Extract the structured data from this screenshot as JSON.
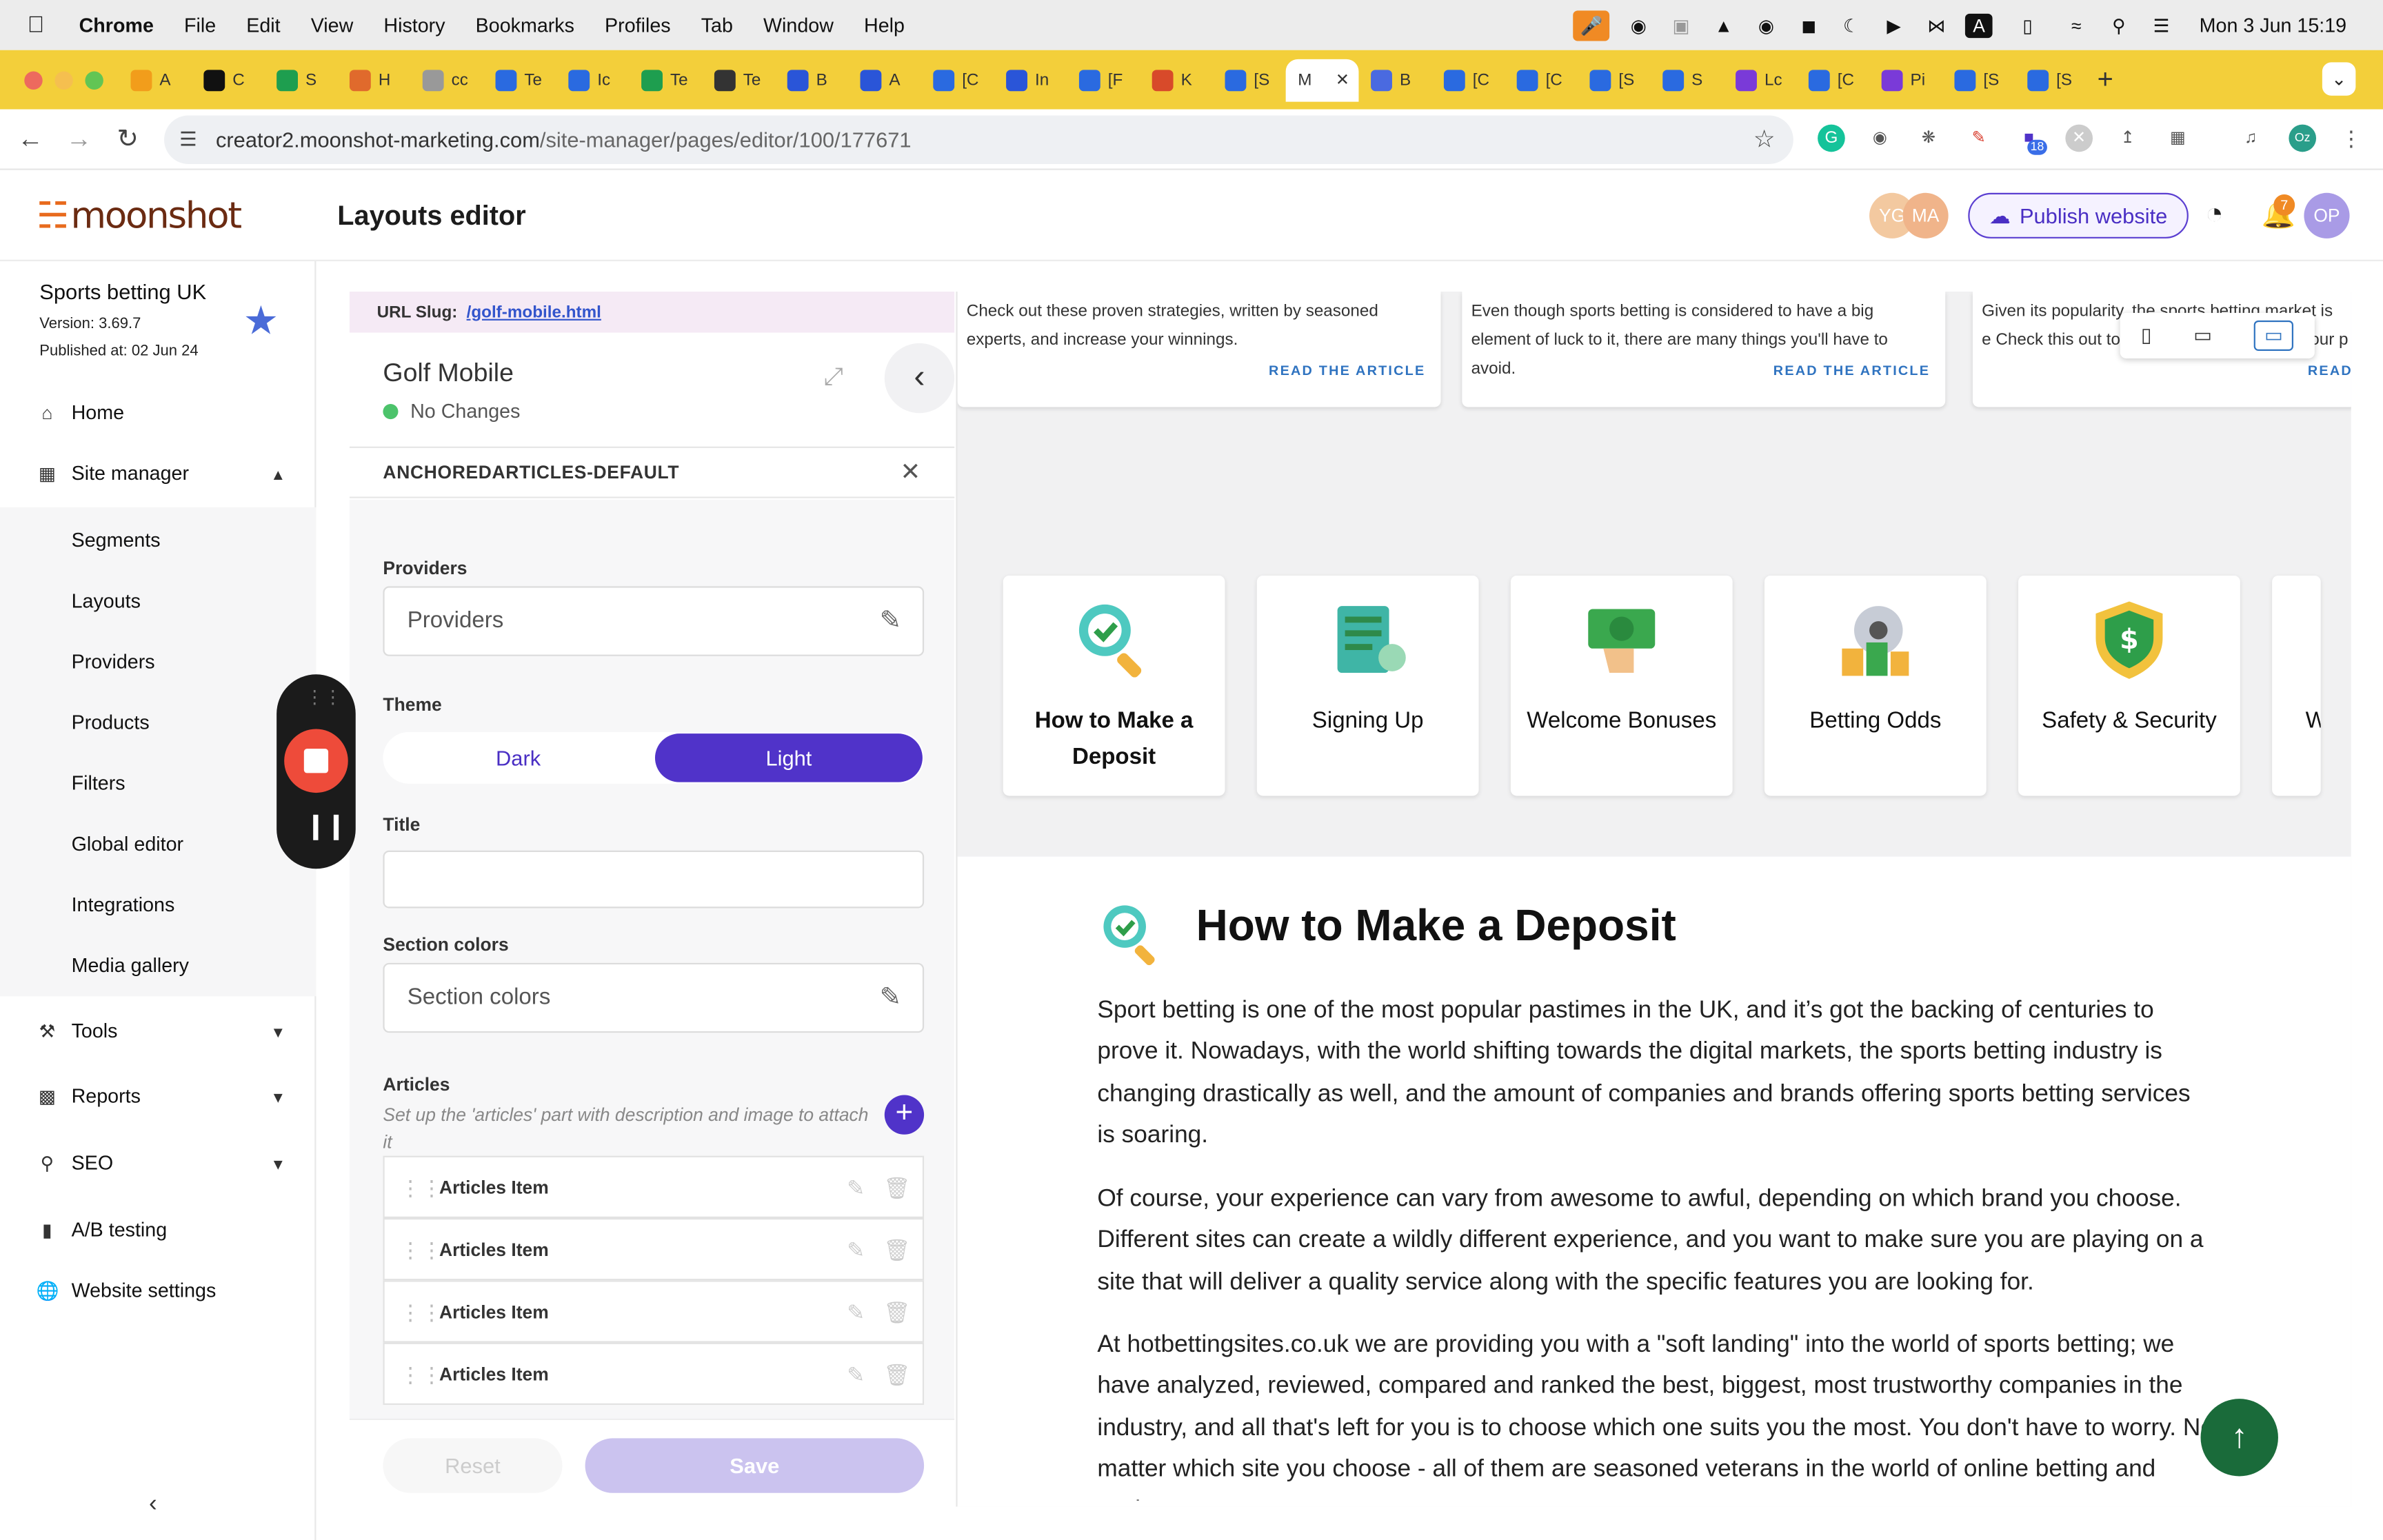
{
  "menubar": {
    "app": "Chrome",
    "items": [
      "File",
      "Edit",
      "View",
      "History",
      "Bookmarks",
      "Profiles",
      "Tab",
      "Window",
      "Help"
    ],
    "clock": "Mon 3 Jun  15:19"
  },
  "tabs": {
    "labels": [
      "A",
      "C",
      "S",
      "H",
      "cc",
      "Te",
      "Ic",
      "Te",
      "Te",
      "B",
      "A",
      "[C",
      "In",
      "[F",
      "K",
      "[S",
      "M",
      "B",
      "[C",
      "[C",
      "[S",
      "S",
      "Lc",
      "[C",
      "Pi",
      "[S",
      "[S"
    ],
    "active_index": 16,
    "colors": [
      "#f29d1b",
      "#111111",
      "#1e9e4f",
      "#e06a2c",
      "#999999",
      "#2a6ae0",
      "#2a6ae0",
      "#1e9e4f",
      "#333333",
      "#2a55d8",
      "#2a55d8",
      "#2a6ae0",
      "#2a55d8",
      "#2a6ae0",
      "#d84a2a",
      "#2a6ae0",
      "#2a6ae0",
      "#4a6ae0",
      "#2a6ae0",
      "#2a6ae0",
      "#2a6ae0",
      "#2a6ae0",
      "#7a3ad8",
      "#2a6ae0",
      "#7a3ad8",
      "#2a6ae0",
      "#2a6ae0"
    ]
  },
  "address": {
    "host": "creator2.moonshot-marketing.com",
    "path": "/site-manager/pages/editor/100/177671",
    "ext_badge": "18",
    "profile": "Oz"
  },
  "header": {
    "logo": "moonshot",
    "page_title": "Layouts editor",
    "avatars": [
      "YG",
      "MA"
    ],
    "publish": "Publish website",
    "notif_count": "7",
    "user": "OP"
  },
  "sidebar": {
    "site_name": "Sports betting UK",
    "version": "Version: 3.69.7",
    "published": "Published at: 02 Jun 24",
    "home": "Home",
    "site_manager": "Site manager",
    "sub": [
      "Segments",
      "Layouts",
      "Providers",
      "Products",
      "Filters",
      "Global editor",
      "Integrations",
      "Media gallery"
    ],
    "tools": "Tools",
    "reports": "Reports",
    "seo": "SEO",
    "ab": "A/B testing",
    "settings": "Website settings"
  },
  "editor": {
    "slug_label": "URL Slug:",
    "slug": "/golf-mobile.html",
    "title": "Golf Mobile",
    "status": "No Changes",
    "section": "ANCHOREDARTICLES-DEFAULT",
    "providers_label": "Providers",
    "providers_value": "Providers",
    "theme_label": "Theme",
    "theme_dark": "Dark",
    "theme_light": "Light",
    "title_label": "Title",
    "colors_label": "Section colors",
    "colors_value": "Section colors",
    "articles_label": "Articles",
    "articles_desc": "Set up the 'articles' part with description and image to attach it",
    "items": [
      "Articles Item",
      "Articles Item",
      "Articles Item",
      "Articles Item"
    ],
    "reset": "Reset",
    "save": "Save"
  },
  "preview": {
    "cards": [
      {
        "text": "Check out these proven strategies, written by seasoned experts, and increase your winnings.",
        "read": "READ THE ARTICLE"
      },
      {
        "text": "Even though sports betting is considered to have a big element of luck to it, there are many things you'll have to avoid.",
        "read": "READ THE ARTICLE"
      },
      {
        "text": "Given its popularity, the sports betting market is e Check this out to s",
        "text_tail": "our p",
        "read": "READ"
      }
    ],
    "topics": [
      "How to Make a Deposit",
      "Signing Up",
      "Welcome Bonuses",
      "Betting Odds",
      "Safety & Security",
      "W"
    ],
    "article_title": "How to Make a Deposit",
    "paragraphs": [
      "Sport betting is one of the most popular pastimes in the UK, and it’s got the backing of centuries to prove it. Nowadays, with the world shifting towards the digital markets, the sports betting industry is changing drastically as well, and the amount of companies and brands offering sports betting services is soaring.",
      "Of course, your experience can vary from awesome to awful, depending on which brand you choose. Different sites can create a wildly different experience, and you want to make sure you are playing on a site that will deliver a quality service along with the specific features you are looking for.",
      "At hotbettingsites.co.uk we are providing you with a \"soft landing\" into the world of sports betting; we have analyzed, reviewed, compared and ranked the best, biggest, most trustworthy companies in the industry, and all that's left for you is to choose which one suits you the most. You don't have to worry. No matter which site you choose - all of them are seasoned veterans in the world of online betting and casino."
    ]
  },
  "colors": {
    "accent": "#5033c9",
    "tab_bar": "#f3cf3a",
    "to_top": "#1a6b3a"
  }
}
